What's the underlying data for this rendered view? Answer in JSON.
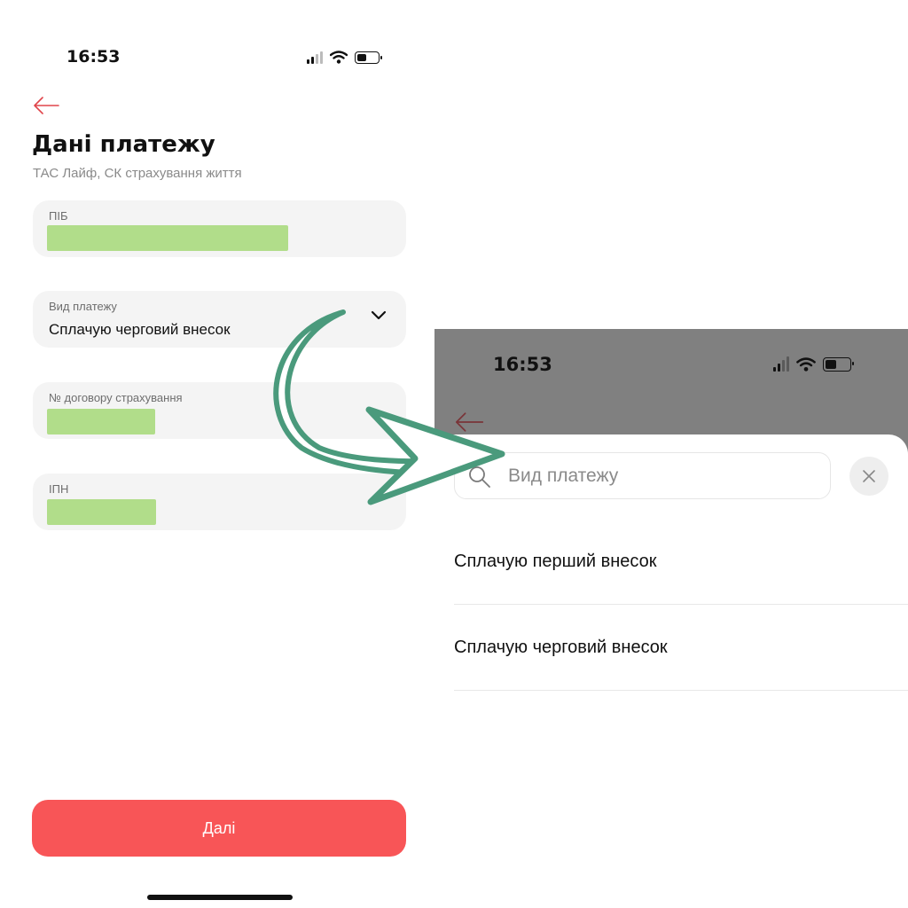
{
  "left_screen": {
    "status_bar": {
      "time": "16:53"
    },
    "title": "Дані платежу",
    "subtitle": "ТАС Лайф, СК страхування життя",
    "fields": {
      "full_name": {
        "label": "ПІБ",
        "value": ""
      },
      "payment_type": {
        "label": "Вид платежу",
        "value": "Сплачую черговий внесок"
      },
      "contract_number": {
        "label": "№ договору страхування",
        "value": ""
      },
      "tax_id": {
        "label": "ІПН",
        "value": ""
      }
    },
    "next_button_label": "Далі"
  },
  "right_screen": {
    "status_bar": {
      "time": "16:53"
    },
    "search_placeholder": "Вид платежу",
    "options": [
      "Сплачую перший внесок",
      "Сплачую черговий внесок"
    ]
  },
  "icons": [
    "back-arrow-icon",
    "chevron-down-icon",
    "search-icon",
    "close-icon",
    "wifi-icon",
    "signal-icon",
    "battery-icon",
    "curved-arrow-icon"
  ],
  "colors": {
    "accent": "#f85557",
    "redaction": "#b1dd8a",
    "field_background": "#f4f4f4",
    "overlay_dim": "#808080",
    "annotation_arrow": "#4a9a7c"
  }
}
